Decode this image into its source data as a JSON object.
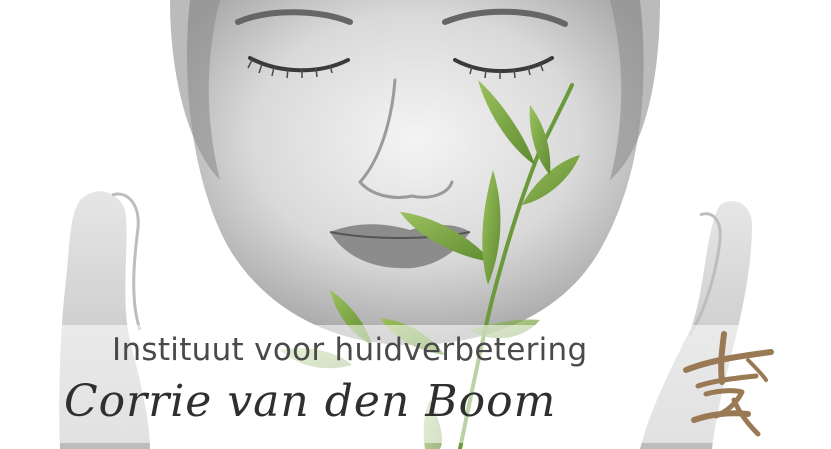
{
  "header": {
    "subtitle": "Instituut voor huidverbetering",
    "title": "Corrie van den Boom"
  },
  "logo": {
    "icon": "calligraphy-mark-icon",
    "color": "#9a7a55"
  },
  "photo": {
    "icon": "face-with-leaves-image"
  },
  "colors": {
    "leaf": "#7fa84a",
    "text_dark": "#2f2f2f",
    "text_gray": "#4a4a4a"
  }
}
